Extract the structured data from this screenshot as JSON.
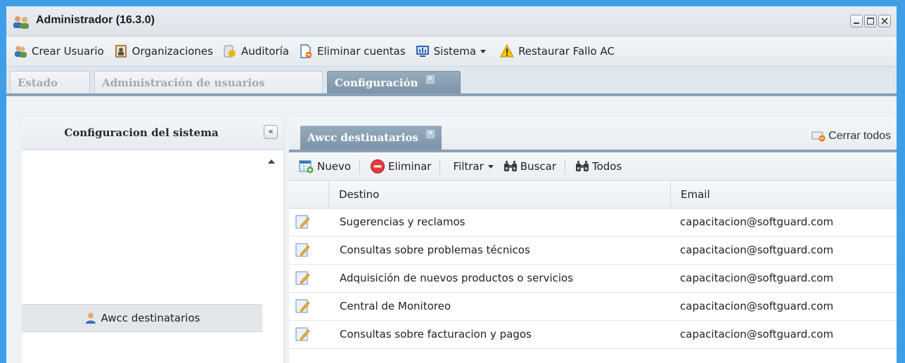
{
  "window": {
    "title": "Administrador (16.3.0)"
  },
  "toolbar": {
    "items": [
      {
        "label": "Crear Usuario",
        "icon": "users-icon"
      },
      {
        "label": "Organizaciones",
        "icon": "organization-icon"
      },
      {
        "label": "Auditoría",
        "icon": "audit-icon"
      },
      {
        "label": "Eliminar cuentas",
        "icon": "delete-accounts-icon"
      },
      {
        "label": "Sistema",
        "icon": "system-icon"
      },
      {
        "label": "Restaurar Fallo AC",
        "icon": "warning-icon"
      }
    ]
  },
  "main_tabs": [
    {
      "label": "Estado",
      "active": false
    },
    {
      "label": "Administración de usuarios",
      "active": false
    },
    {
      "label": "Configuración",
      "active": true
    }
  ],
  "left_panel": {
    "title": "Configuracion del sistema",
    "collapse_glyph": "«",
    "items": [
      {
        "label": "Awcc destinatarios",
        "icon": "user-icon"
      }
    ]
  },
  "right_panel": {
    "tab_label": "Awcc destinatarios",
    "close_all_label": "Cerrar todos",
    "toolbar": {
      "new_label": "Nuevo",
      "delete_label": "Eliminar",
      "filter_label": "Filtrar",
      "search_label": "Buscar",
      "all_label": "Todos"
    },
    "grid": {
      "columns": [
        "Destino",
        "Email"
      ],
      "rows": [
        {
          "destino": "Sugerencias y reclamos",
          "email": "capacitacion@softguard.com"
        },
        {
          "destino": "Consultas sobre problemas técnicos",
          "email": "capacitacion@softguard.com"
        },
        {
          "destino": "Adquisición de nuevos productos o servicios",
          "email": "capacitacion@softguard.com"
        },
        {
          "destino": "Central de Monitoreo",
          "email": "capacitacion@softguard.com"
        },
        {
          "destino": "Consultas sobre facturacion y pagos",
          "email": "capacitacion@softguard.com"
        }
      ]
    }
  },
  "colors": {
    "background": "#3f9ee8",
    "active_tab": "#8aa0b6"
  }
}
